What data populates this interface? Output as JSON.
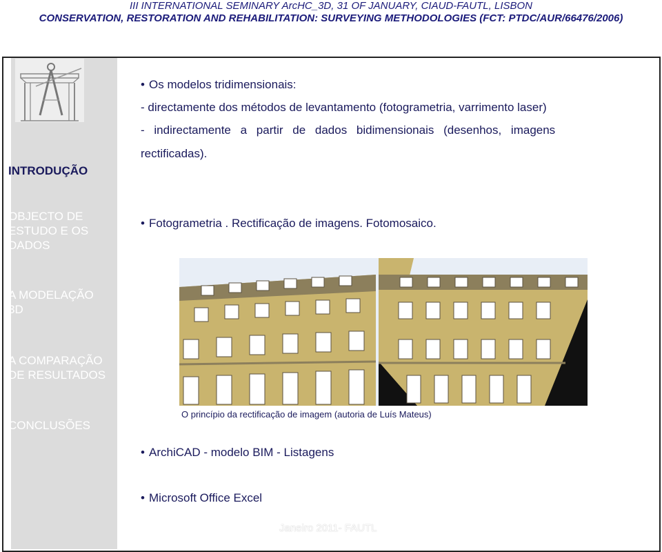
{
  "header": {
    "line1": "III INTERNATIONAL SEMINARY ArcHC_3D, 31 OF JANUARY, CIAUD-FAUTL, LISBON",
    "line2": "CONSERVATION, RESTORATION AND REHABILITATION: SURVEYING METHODOLOGIES (FCT: PTDC/AUR/66476/2006)"
  },
  "sidebar": {
    "items": [
      {
        "label": "INTRODUÇÃO",
        "active": true
      },
      {
        "label": "OBJECTO DE ESTUDO E OS DADOS",
        "active": false
      },
      {
        "label": "A MODELAÇÃO 3D",
        "active": false
      },
      {
        "label": "A COMPARAÇÃO DE RESULTADOS",
        "active": false
      },
      {
        "label": "CONCLUSÕES",
        "active": false
      }
    ]
  },
  "content": {
    "bullet1": "Os modelos tridimensionais:",
    "line_direct": "- directamente dos métodos de levantamento (fotogrametria, varrimento laser)",
    "line_indirect": "- indirectamente a partir de dados bidimensionais (desenhos, imagens",
    "line_indirect2": "rectificadas).",
    "bullet2": "Fotogrametria . Rectificação de imagens. Fotomosaico.",
    "caption": "O princípio da rectificação de imagem (autoria de Luís Mateus)",
    "bullet3": "ArchiCAD - modelo BIM - Listagens",
    "bullet4": "Microsoft Office Excel"
  },
  "footer": "Janeiro 2011- FAUTL",
  "colors": {
    "text": "#1a1a5c",
    "sidebar": "#dcdcdc",
    "facade": "#c9b46e",
    "sky": "#e8eef6"
  },
  "icons": {
    "logo": "drafting-compass-logo"
  }
}
